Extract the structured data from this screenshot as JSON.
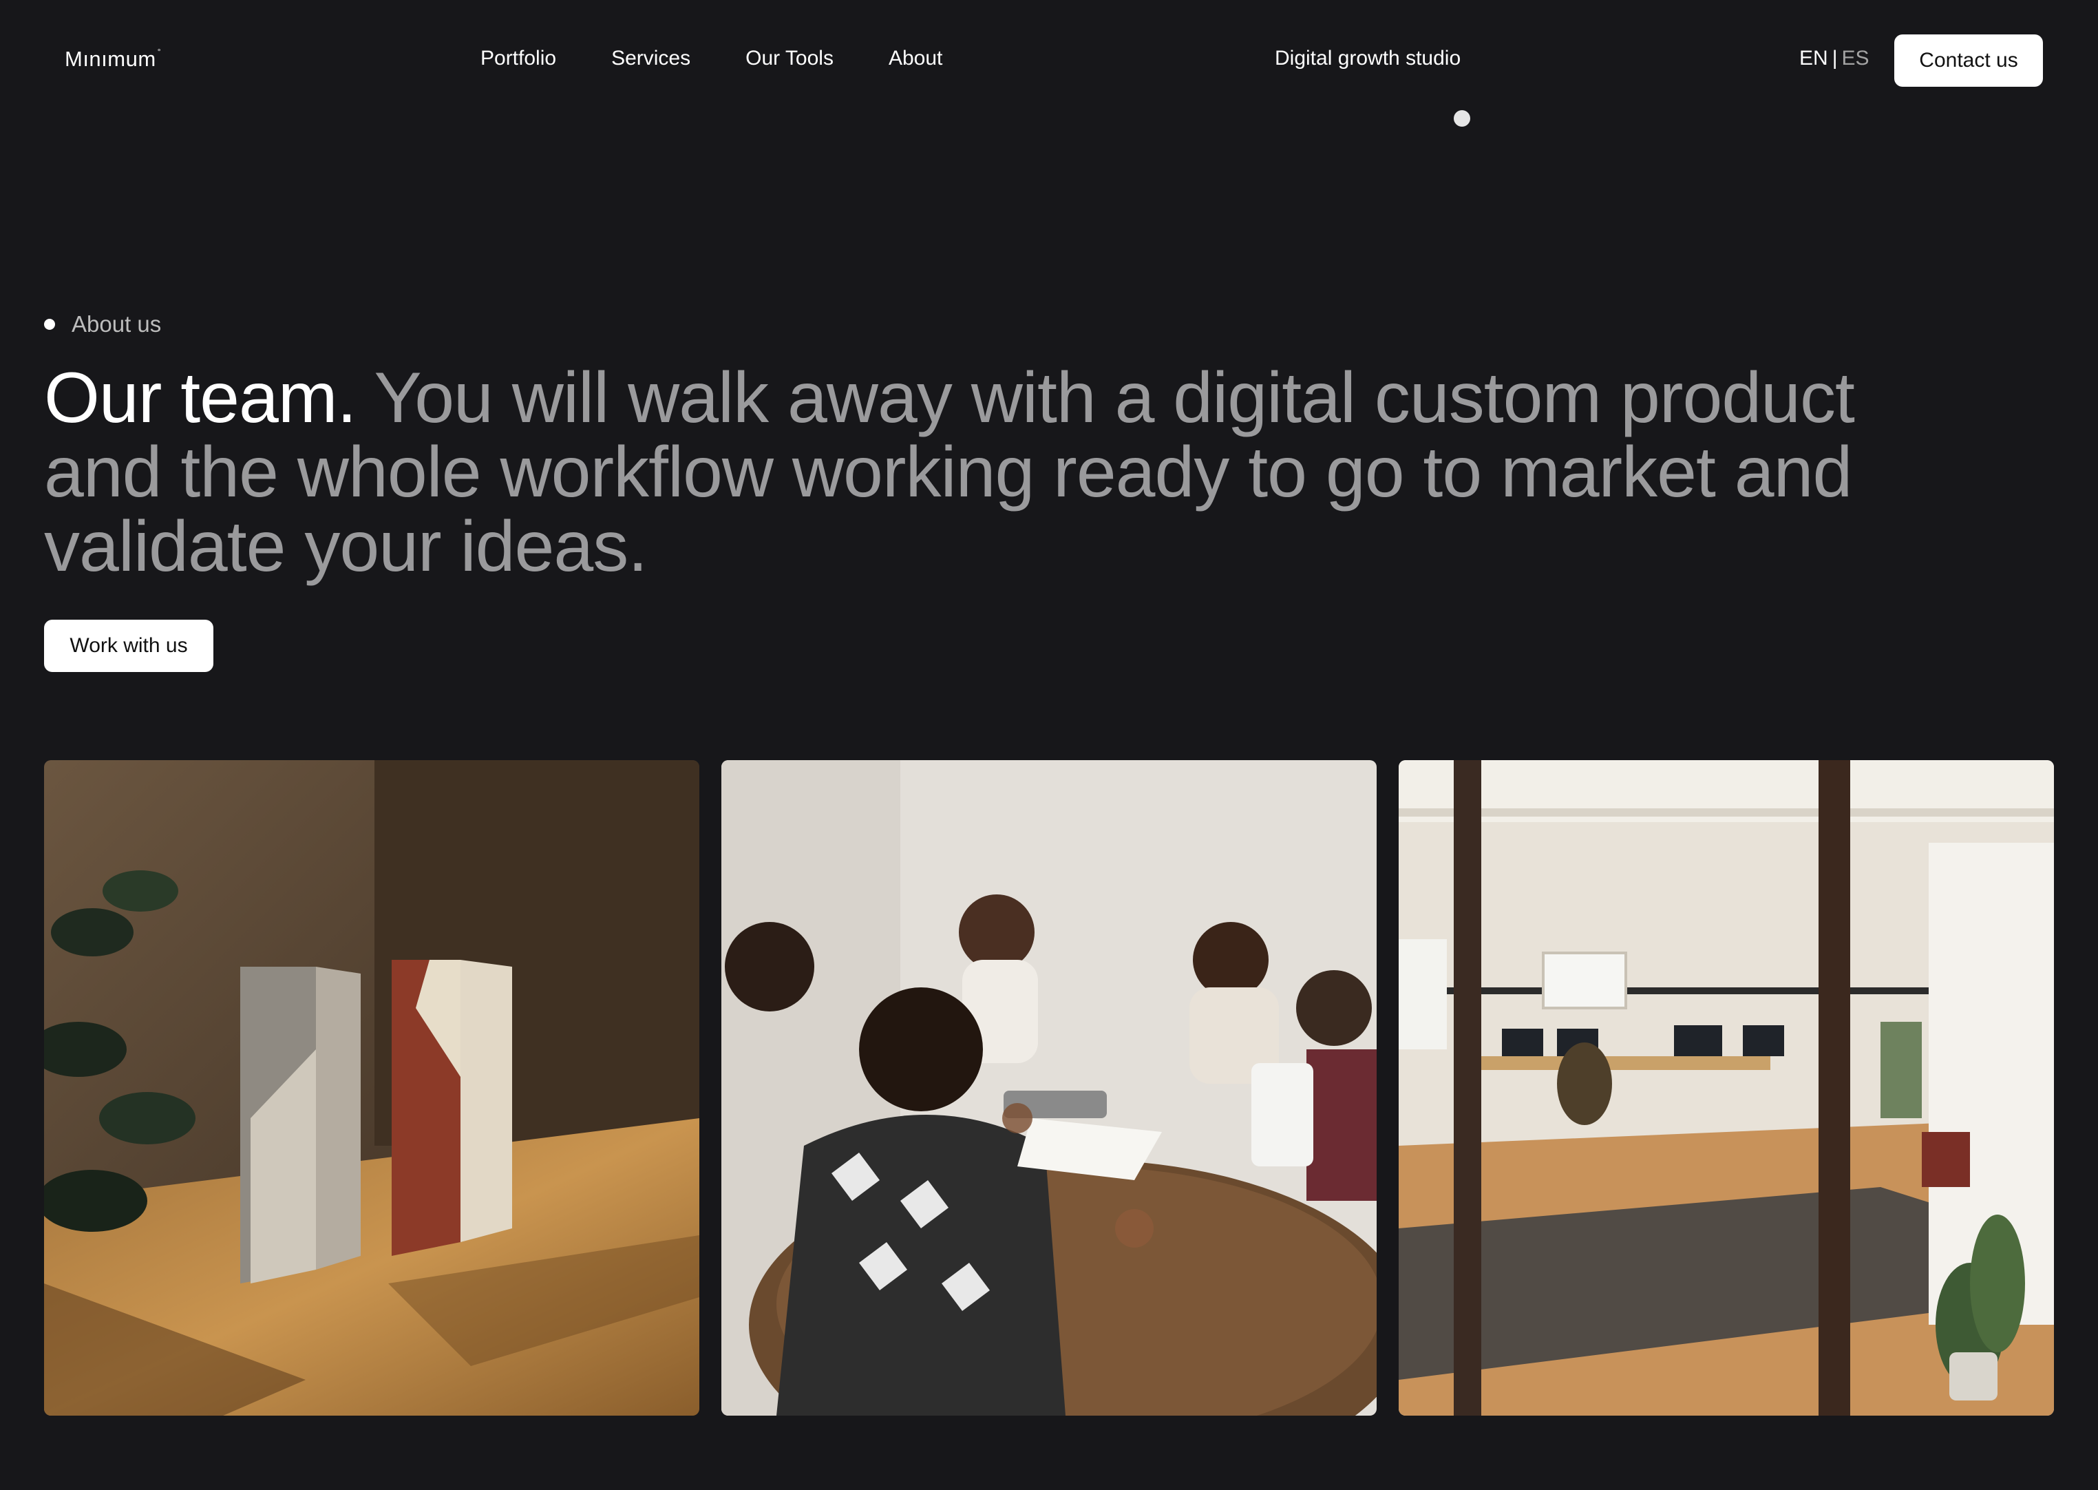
{
  "header": {
    "logo": "Mınımum",
    "logo_mark": "°",
    "nav": [
      "Portfolio",
      "Services",
      "Our Tools",
      "About"
    ],
    "tagline": "Digital growth studio",
    "lang_active": "EN",
    "lang_sep": "|",
    "lang_inactive": "ES",
    "contact_label": "Contact us"
  },
  "hero": {
    "eyebrow": "About us",
    "headline_lead": "Our team.",
    "headline_rest": "You will walk away with a digital custom product and the whole workflow working ready to go to market and validate your ideas.",
    "cta_label": "Work with us"
  },
  "gallery": {
    "items": [
      "award-trophies-photo",
      "team-meeting-photo",
      "office-space-photo"
    ]
  },
  "colors": {
    "background": "#17171a",
    "text_primary": "#ffffff",
    "text_muted": "#9a9a9c",
    "button_bg": "#ffffff",
    "button_text": "#111111"
  }
}
